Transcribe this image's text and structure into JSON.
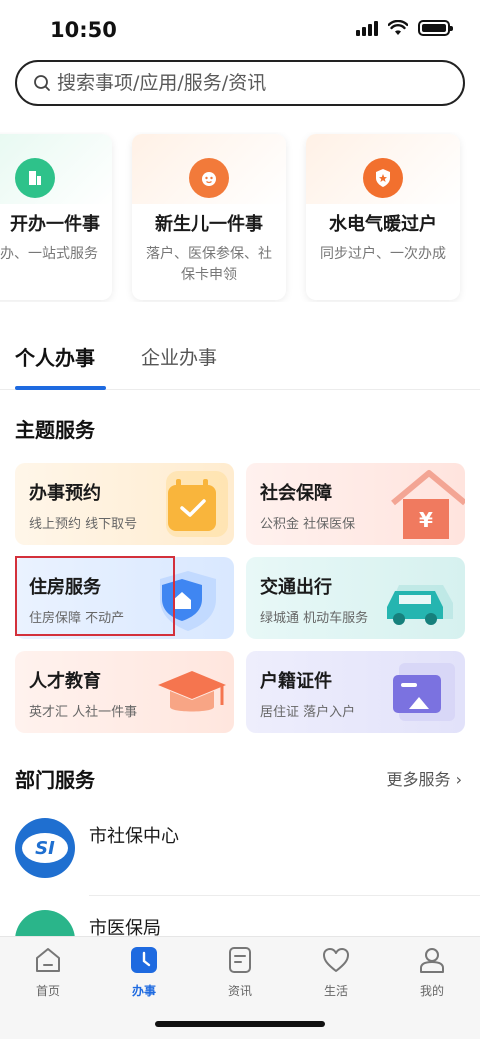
{
  "status": {
    "time": "10:50"
  },
  "search": {
    "placeholder": "搜索事项/应用/服务/资讯"
  },
  "quick_cards": [
    {
      "title": "开办一件事",
      "desc": "一次办、一站式服务",
      "icon": "building-icon",
      "color": "#2ec28a"
    },
    {
      "title": "新生儿一件事",
      "desc": "落户、医保参保、社保卡申领",
      "icon": "baby-icon",
      "color": "#f27a3a"
    },
    {
      "title": "水电气暖过户",
      "desc": "同步过户、一次办成",
      "icon": "shield-star-icon",
      "color": "#f2702e"
    }
  ],
  "tabs": {
    "personal": "个人办事",
    "enterprise": "企业办事"
  },
  "theme": {
    "title": "主题服务",
    "tiles": [
      {
        "title": "办事预约",
        "desc": "线上预约 线下取号"
      },
      {
        "title": "社会保障",
        "desc": "公积金 社保医保"
      },
      {
        "title": "住房服务",
        "desc": "住房保障 不动产"
      },
      {
        "title": "交通出行",
        "desc": "绿城通 机动车服务"
      },
      {
        "title": "人才教育",
        "desc": "英才汇 人社一件事"
      },
      {
        "title": "户籍证件",
        "desc": "居住证 落户入户"
      }
    ]
  },
  "departments": {
    "title": "部门服务",
    "more": "更多服务 ›",
    "items": [
      {
        "name": "市社保中心",
        "logo_text": "SI"
      },
      {
        "name": "市医保局"
      }
    ]
  },
  "bottom_nav": [
    {
      "label": "首页",
      "icon": "home-icon"
    },
    {
      "label": "办事",
      "icon": "clock-icon"
    },
    {
      "label": "资讯",
      "icon": "news-icon"
    },
    {
      "label": "生活",
      "icon": "heart-icon"
    },
    {
      "label": "我的",
      "icon": "user-icon"
    }
  ],
  "colors": {
    "accent": "#1e6ae0",
    "highlight": "#d3303b"
  }
}
